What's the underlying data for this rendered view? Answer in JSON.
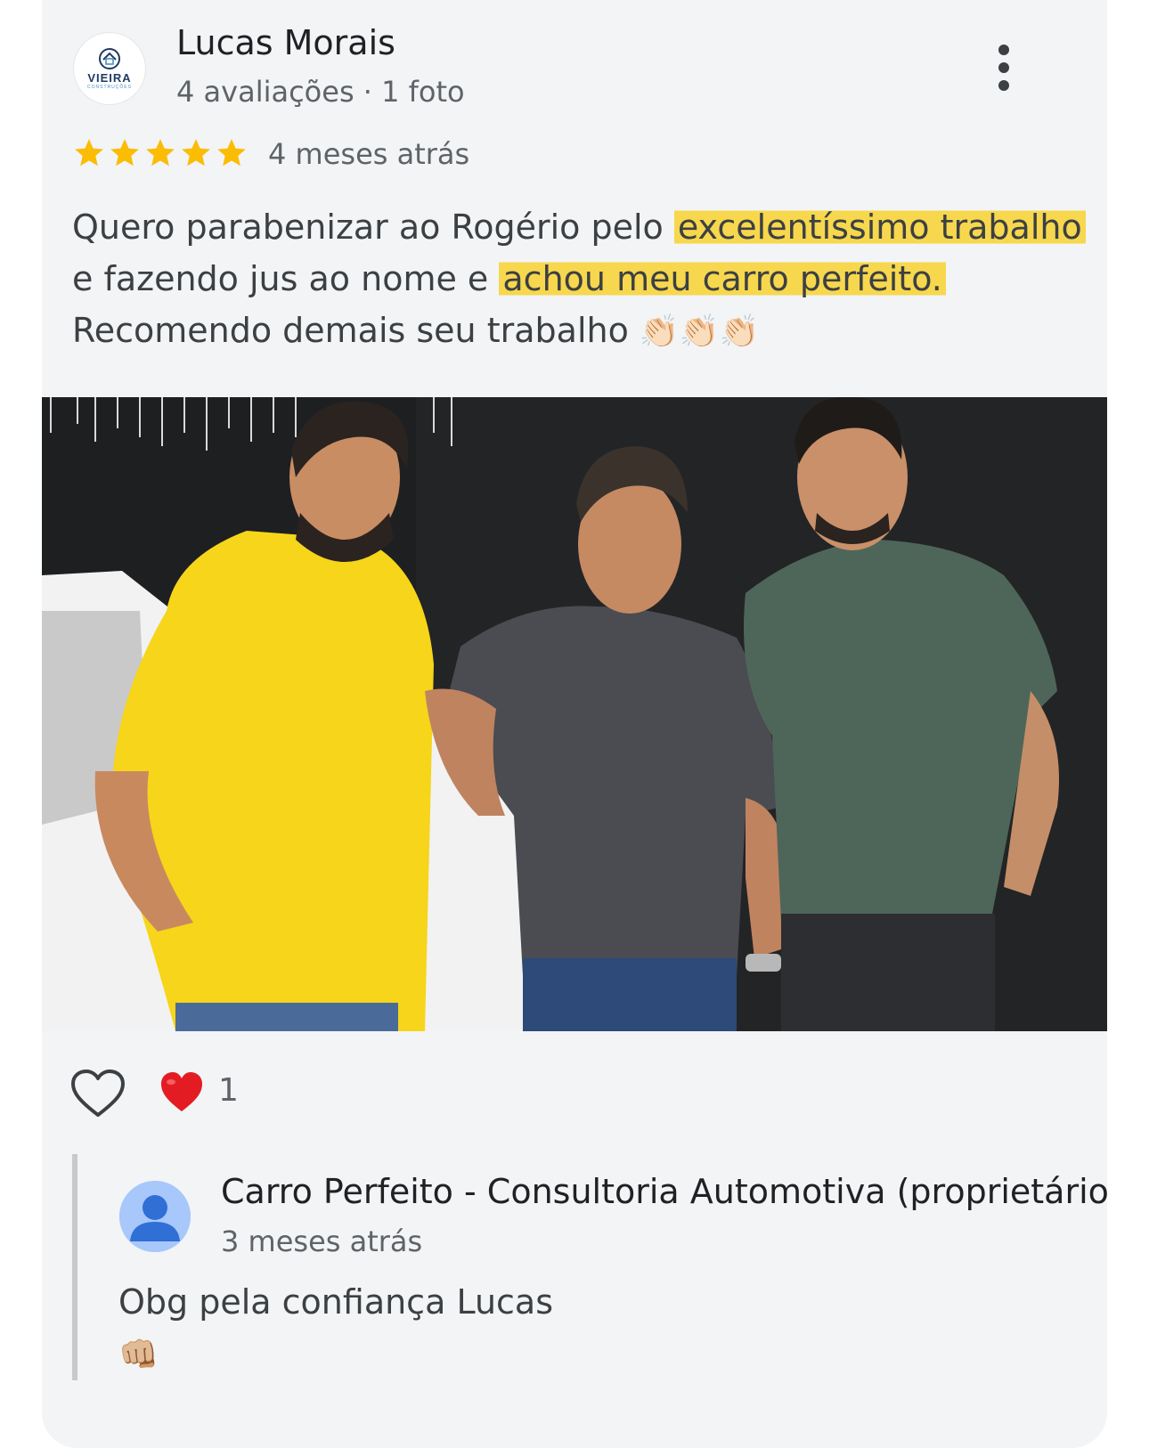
{
  "review": {
    "reviewer_name": "Lucas Morais",
    "reviewer_meta": "4 avaliações · 1 foto",
    "avatar_logo_text": "VIEIRA",
    "avatar_logo_sub": "CONSTRUÇÕES",
    "rating": 5,
    "rating_max": 5,
    "time": "4 meses atrás",
    "text_lines": [
      {
        "pre": "Quero parabenizar ao Rogério pelo ",
        "hl": "excelentíssimo trabalho",
        "post": ""
      },
      {
        "pre": "e fazendo jus ao nome e ",
        "hl": "achou meu carro perfeito.",
        "post": ""
      },
      {
        "pre": "Recomendo demais seu trabalho ",
        "hl": "",
        "post": "👏🏻👏🏻👏🏻"
      }
    ],
    "highlight_color": "#f7d74d",
    "star_color": "#fbbc04"
  },
  "reactions": {
    "like_icon": "heart-outline-icon",
    "reaction_icon": "red-heart-icon",
    "count": "1"
  },
  "reply": {
    "owner_name": "Carro Perfeito - Consultoria Automotiva (proprietário)",
    "time": "3 meses atrás",
    "text": "Obg pela confiança Lucas",
    "emoji": "👊🏼",
    "avatar_icon": "default-person-icon"
  }
}
